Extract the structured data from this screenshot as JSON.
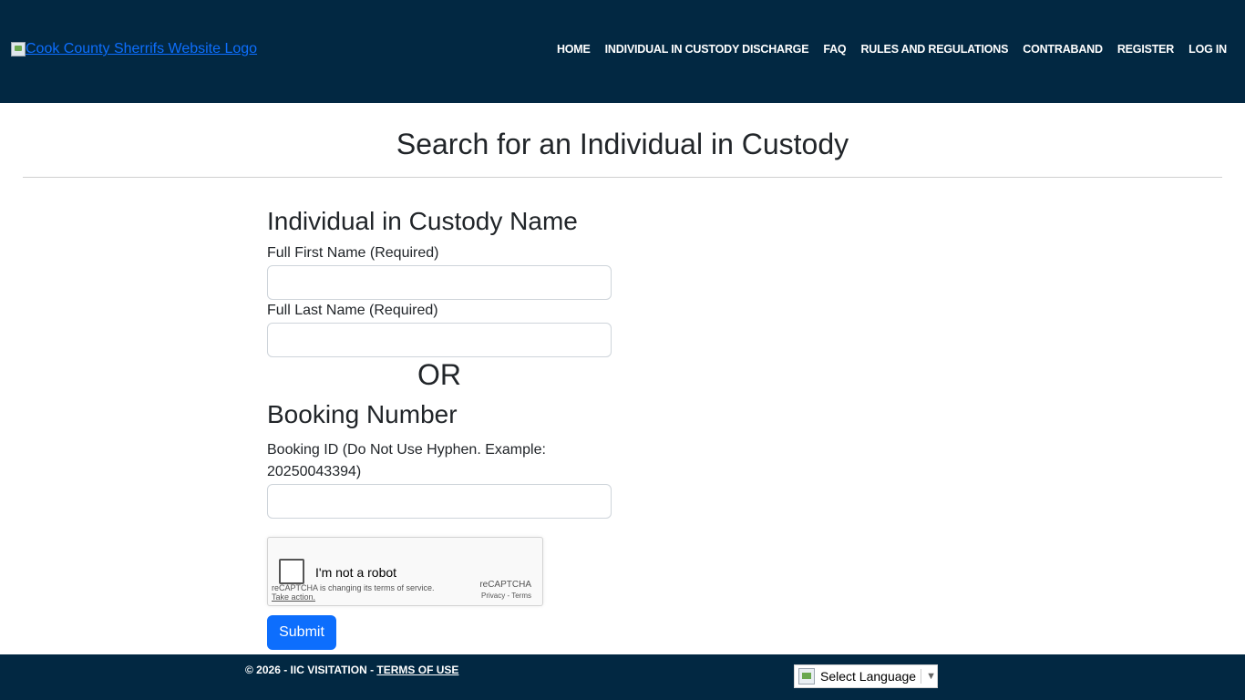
{
  "header": {
    "logo_alt": "Cook County Sherrifs Website Logo",
    "nav": [
      {
        "label": "HOME"
      },
      {
        "label": "INDIVIDUAL IN CUSTODY DISCHARGE"
      },
      {
        "label": "FAQ"
      },
      {
        "label": "RULES AND REGULATIONS"
      },
      {
        "label": "CONTRABAND"
      },
      {
        "label": "REGISTER"
      },
      {
        "label": "LOG IN"
      }
    ]
  },
  "main": {
    "title": "Search for an Individual in Custody",
    "name_section": {
      "heading": "Individual in Custody Name",
      "first_name_label": "Full First Name (Required)",
      "first_name_value": "",
      "last_name_label": "Full Last Name (Required)",
      "last_name_value": ""
    },
    "or_text": "OR",
    "booking_section": {
      "heading": "Booking Number",
      "booking_label": "Booking ID (Do Not Use Hyphen. Example: 20250043394)",
      "booking_value": ""
    },
    "recaptcha": {
      "label": "I'm not a robot",
      "notice": "reCAPTCHA is changing its terms of service.",
      "action": "Take action.",
      "brand": "reCAPTCHA",
      "privacy": "Privacy",
      "terms": "Terms"
    },
    "submit_label": "Submit"
  },
  "footer": {
    "copyright": "© 2026 - IIC VISITATION - ",
    "glyph": "",
    "terms_label": "TERMS OF USE",
    "language_select": "Select Language"
  },
  "colors": {
    "header_bg": "#022842",
    "primary": "#0d6efd"
  }
}
